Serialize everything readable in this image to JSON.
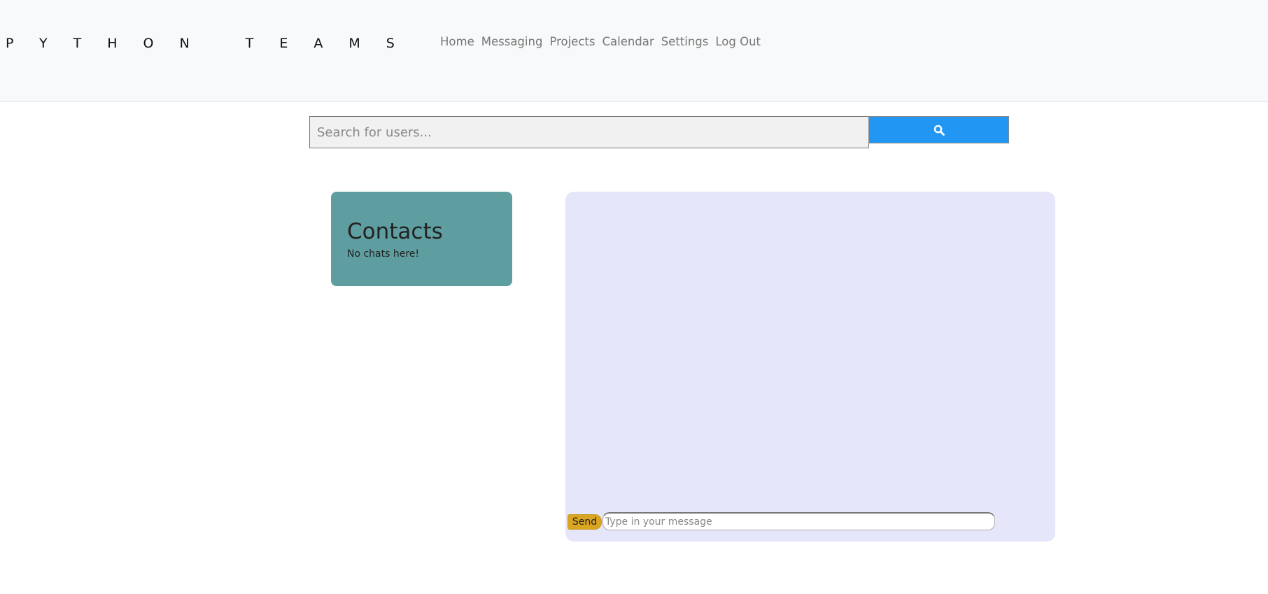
{
  "brand": {
    "title": "PYTHON TEAMS"
  },
  "nav": {
    "items": [
      "Home",
      "Messaging",
      "Projects",
      "Calendar",
      "Settings",
      "Log Out"
    ]
  },
  "search": {
    "placeholder": "Search for users...",
    "button_icon": "search-icon"
  },
  "contacts": {
    "title": "Contacts",
    "empty_text": "No chats here!"
  },
  "chat": {
    "send_label": "Send",
    "input_placeholder": "Type in your message"
  },
  "colors": {
    "navbar_bg": "#f8f9fa",
    "search_button": "#2196f3",
    "contacts_bg": "#5f9ea0",
    "chat_bg": "#e6e6fa",
    "send_button": "#daa520"
  }
}
